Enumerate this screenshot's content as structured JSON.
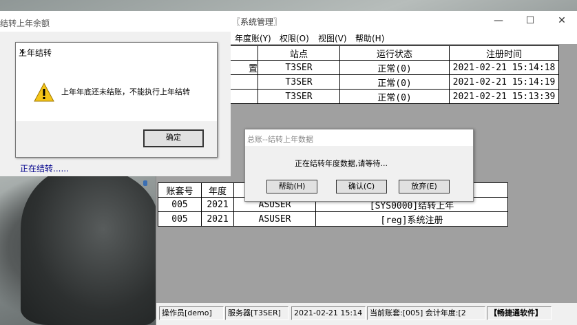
{
  "main_window": {
    "title": "〖系统管理〗",
    "controls": {
      "minimize": "—",
      "maximize": "☐",
      "close": "✕"
    },
    "menu": [
      "年度账(Y)",
      "权限(O)",
      "视图(V)",
      "帮助(H)"
    ],
    "table1": {
      "headers": [
        "站点",
        "运行状态",
        "注册时间"
      ],
      "rows": [
        [
          "置",
          "T3SER",
          "正常(0)",
          "2021-02-21 15:14:18"
        ],
        [
          "",
          "T3SER",
          "正常(0)",
          "2021-02-21 15:14:19"
        ],
        [
          "",
          "T3SER",
          "正常(0)",
          "2021-02-21 15:13:39"
        ]
      ]
    },
    "table2": {
      "headers": [
        "账套号",
        "年度",
        "",
        ""
      ],
      "rows": [
        [
          "005",
          "2021",
          "ASUSER",
          "[SYS0000]结转上年"
        ],
        [
          "005",
          "2021",
          "ASUSER",
          "[reg]系统注册"
        ]
      ]
    },
    "statusbar": {
      "operator": "操作员[demo]",
      "server": "服务器[T3SER]",
      "datetime": "2021-02-21 15:14",
      "account": "当前账套:[005] 会计年度:[2",
      "brand": "【畅捷通软件】"
    }
  },
  "left_dialog": {
    "title": "结转上年余额",
    "progress": "正在结转......"
  },
  "message_box": {
    "title": "上年结转",
    "close": "✕",
    "icon": "warning-icon",
    "text": "上年年底还未结账，不能执行上年结转",
    "ok": "确定"
  },
  "center_dialog": {
    "title": "总账--结转上年数据",
    "message": "正在结转年度数据,请等待...",
    "buttons": [
      "帮助(H)",
      "确认(C)",
      "放弃(E)"
    ]
  }
}
